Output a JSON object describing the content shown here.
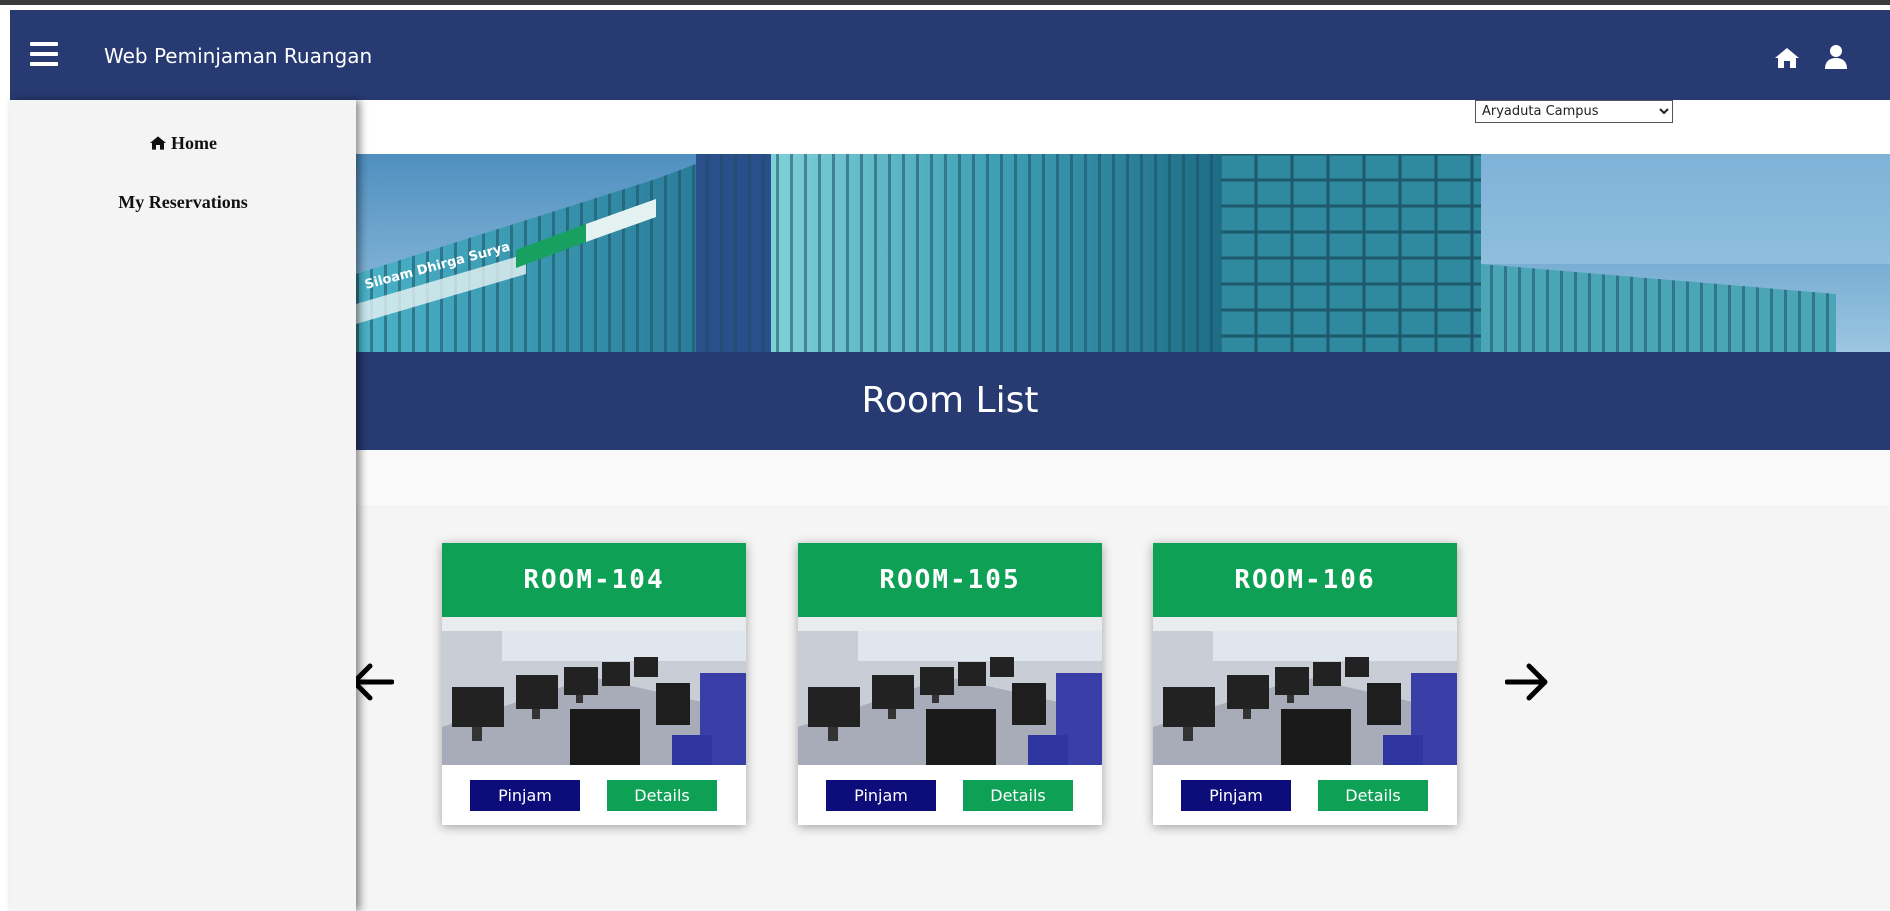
{
  "navbar": {
    "title": "Web Peminjaman Ruangan",
    "menu_icon": "hamburger-menu-icon",
    "home_icon": "home-icon",
    "user_icon": "user-icon"
  },
  "sidebar": {
    "items": [
      {
        "label": "Home",
        "icon": "home-icon"
      },
      {
        "label": "My Reservations"
      }
    ]
  },
  "campus_select": {
    "selected": "Aryaduta Campus"
  },
  "banner": {
    "sign_text": "Siloam Dhirga Surya"
  },
  "main": {
    "title": "Room List"
  },
  "rooms": [
    {
      "name": "ROOM-104",
      "pinjam_label": "Pinjam",
      "details_label": "Details"
    },
    {
      "name": "ROOM-105",
      "pinjam_label": "Pinjam",
      "details_label": "Details"
    },
    {
      "name": "ROOM-106",
      "pinjam_label": "Pinjam",
      "details_label": "Details"
    }
  ],
  "carousel": {
    "prev_icon": "arrow-left-icon",
    "next_icon": "arrow-right-icon"
  },
  "colors": {
    "navbar": "#273a72",
    "card_header": "#0ea055",
    "pinjam_button": "#0c0c7a",
    "details_button": "#0ea055",
    "sidebar": "#f4f4f4"
  }
}
